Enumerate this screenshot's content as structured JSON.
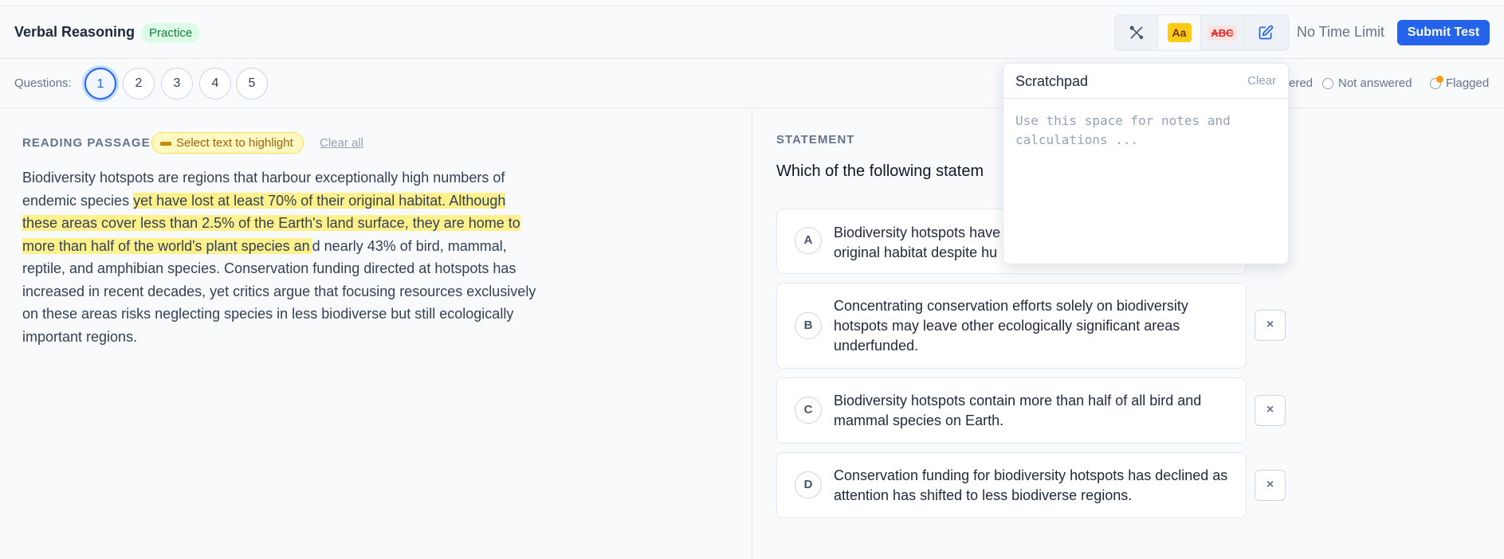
{
  "header": {
    "title": "Verbal Reasoning",
    "mode_badge": "Practice",
    "toolbar": {
      "tools_icon": "tools-icon",
      "text_size_label": "Aa",
      "spellcheck_label": "ABC",
      "notes_icon": "pencil-square-icon"
    },
    "time_label": "No Time Limit",
    "submit_label": "Submit Test"
  },
  "question_nav": {
    "label": "Questions:",
    "questions": [
      "1",
      "2",
      "3",
      "4",
      "5"
    ],
    "current": "1",
    "legend": {
      "answered_partial": "ered",
      "not_answered": "Not answered",
      "flagged": "Flagged"
    }
  },
  "passage": {
    "heading": "READING PASSAGE",
    "highlight_hint": "Select text to highlight",
    "clear_all": "Clear all",
    "text_before": "Biodiversity hotspots are regions that harbour exceptionally high numbers of endemic species ",
    "text_highlighted": "yet have lost at least 70% of their original habitat. Although these areas cover less than 2.5% of the Earth's land surface, they are home to more than half of the world's plant species an",
    "text_after": "d nearly 43% of bird, mammal, reptile, and amphibian species. Conservation funding directed at hotspots has increased in recent decades, yet critics argue that focusing resources exclusively on these areas risks neglecting species in less biodiverse but still ecologically important regions."
  },
  "statement": {
    "heading": "STATEMENT",
    "question": "Which of the following statem",
    "options": [
      {
        "letter": "A",
        "line1": "Biodiversity hotspots have",
        "line2": "original habitat despite hu"
      },
      {
        "letter": "B",
        "text": "Concentrating conservation efforts solely on biodiversity hotspots may leave other ecologically significant areas underfunded."
      },
      {
        "letter": "C",
        "text": "Biodiversity hotspots contain more than half of all bird and mammal species on Earth."
      },
      {
        "letter": "D",
        "text": "Conservation funding for biodiversity hotspots has declined as attention has shifted to less biodiverse regions."
      }
    ],
    "eliminate_label": "×"
  },
  "scratchpad": {
    "title": "Scratchpad",
    "clear_label": "Clear",
    "placeholder": "Use this space for notes and calculations ..."
  },
  "colors": {
    "accent": "#2563eb",
    "highlight": "#fef08a",
    "badge_green": "#dcfce7",
    "flag": "#f59e0b"
  }
}
